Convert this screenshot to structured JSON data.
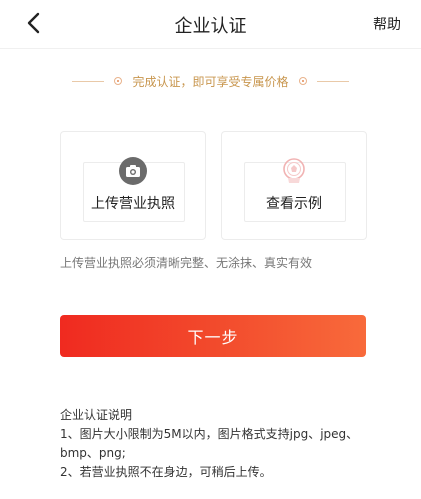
{
  "header": {
    "title": "企业认证",
    "help_label": "帮助"
  },
  "tip": {
    "text": "完成认证，即可享受专属价格"
  },
  "upload_card": {
    "label": "上传营业执照"
  },
  "example_card": {
    "label": "查看示例"
  },
  "requirement_text": "上传营业执照必须清晰完整、无涂抹、真实有效",
  "next_button_label": "下一步",
  "notes": {
    "title": "企业认证说明",
    "lines": [
      "1、图片大小限制为5M以内，图片格式支持jpg、jpeg、bmp、png;",
      "2、若营业执照不在身边，可稍后上传。"
    ]
  },
  "colors": {
    "accent_red": "#f02a20",
    "accent_orange": "#f86a3b",
    "tip_gold": "#c8964e"
  },
  "icons": {
    "back": "back-arrow-icon",
    "camera": "camera-icon",
    "seal": "seal-icon"
  }
}
